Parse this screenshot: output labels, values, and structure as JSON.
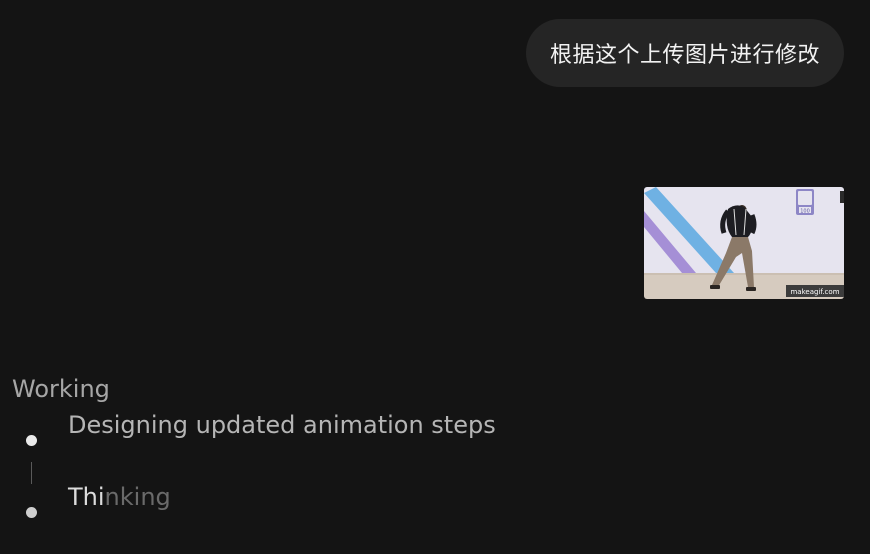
{
  "user_message": {
    "text": "根据这个上传图片进行修改"
  },
  "attachment": {
    "watermark": "makeagif.com",
    "badge": "100"
  },
  "status": {
    "heading": "Working",
    "steps": [
      {
        "label": "Designing updated animation steps",
        "state": "done"
      },
      {
        "label_lit": "Thi",
        "label_dim": "nking",
        "state": "active"
      }
    ]
  }
}
